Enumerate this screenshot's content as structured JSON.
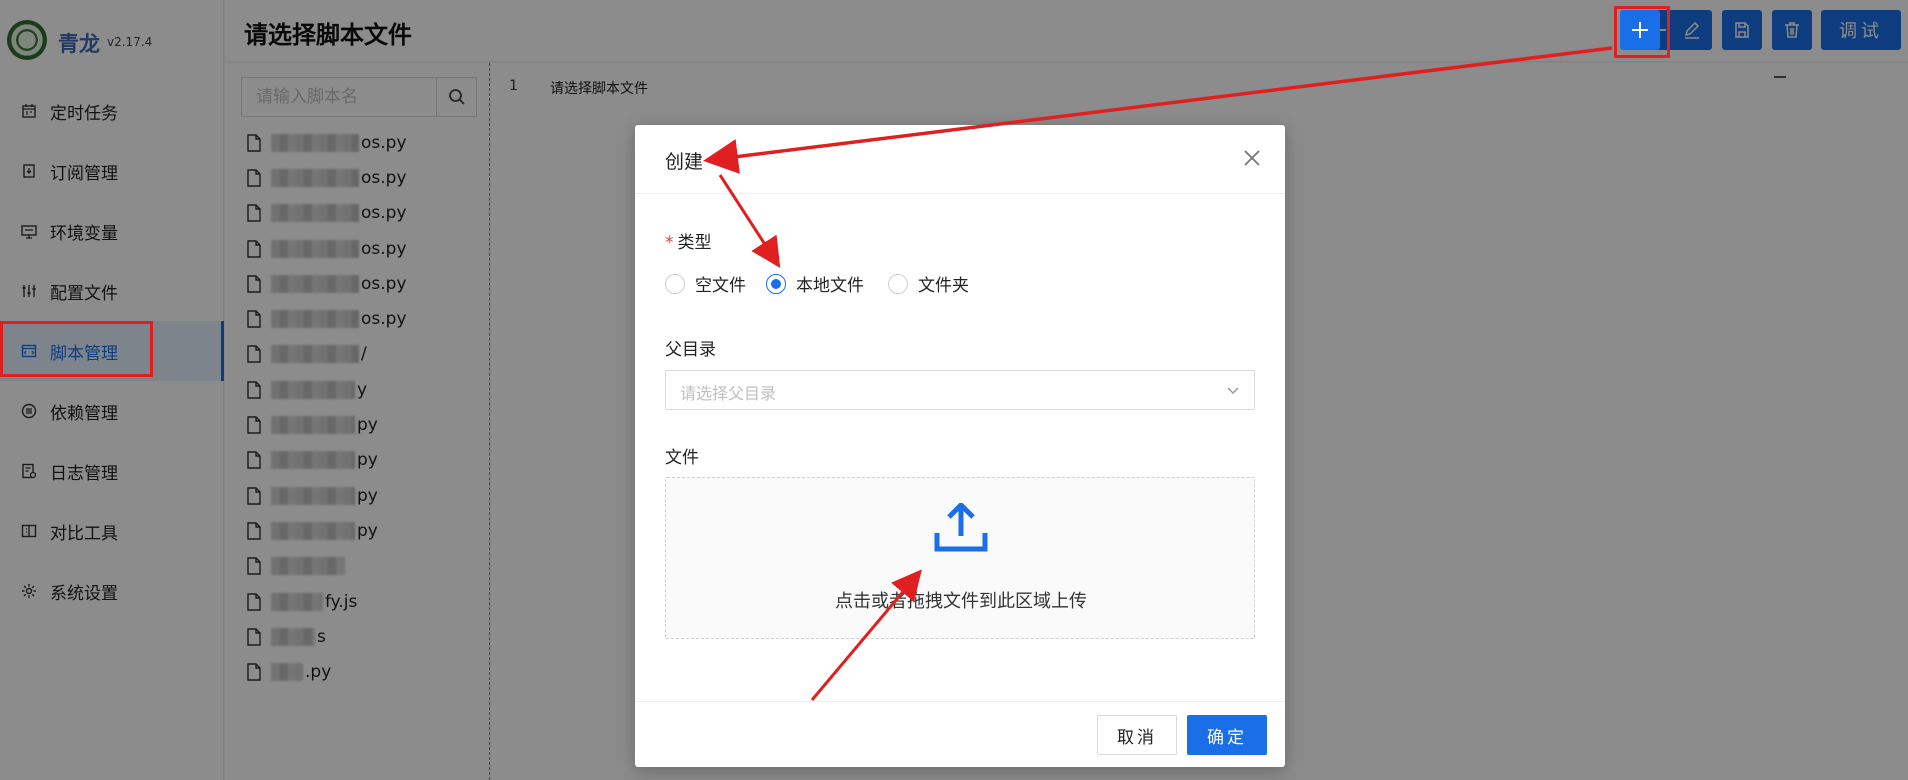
{
  "app": {
    "name": "青龙",
    "version": "v2.17.4"
  },
  "sidebar": {
    "items": [
      {
        "label": "定时任务",
        "icon": "calendar-icon"
      },
      {
        "label": "订阅管理",
        "icon": "subscription-icon"
      },
      {
        "label": "环境变量",
        "icon": "monitor-icon"
      },
      {
        "label": "配置文件",
        "icon": "sliders-icon"
      },
      {
        "label": "脚本管理",
        "icon": "code-icon",
        "active": true
      },
      {
        "label": "依赖管理",
        "icon": "list-icon"
      },
      {
        "label": "日志管理",
        "icon": "log-icon"
      },
      {
        "label": "对比工具",
        "icon": "diff-icon"
      },
      {
        "label": "系统设置",
        "icon": "gear-icon"
      }
    ]
  },
  "header": {
    "title": "请选择脚本文件",
    "debug_label": "调试",
    "tools": [
      "plus-icon",
      "edit-icon",
      "save-icon",
      "delete-icon"
    ]
  },
  "file_panel": {
    "search_placeholder": "请输入脚本名",
    "files": [
      {
        "visible": "os.py"
      },
      {
        "visible": "os.py"
      },
      {
        "visible": "os.py"
      },
      {
        "visible": "os.py"
      },
      {
        "visible": "os.py"
      },
      {
        "visible": "os.py"
      },
      {
        "visible": "/"
      },
      {
        "visible": "y"
      },
      {
        "visible": "py"
      },
      {
        "visible": "py"
      },
      {
        "visible": "py"
      },
      {
        "visible": "py"
      },
      {
        "visible": ""
      },
      {
        "visible": "fy.js"
      },
      {
        "visible": "s"
      },
      {
        "visible": ".py"
      }
    ]
  },
  "editor": {
    "line_number": "1",
    "line_text": "请选择脚本文件"
  },
  "modal": {
    "title": "创建",
    "type_label": "类型",
    "type_options": [
      {
        "label": "空文件",
        "checked": false
      },
      {
        "label": "本地文件",
        "checked": true
      },
      {
        "label": "文件夹",
        "checked": false
      }
    ],
    "parent_label": "父目录",
    "parent_placeholder": "请选择父目录",
    "file_label": "文件",
    "upload_text": "点击或者拖拽文件到此区域上传",
    "cancel_label": "取消",
    "ok_label": "确定"
  },
  "colors": {
    "primary": "#1a6fe8",
    "annotation": "#e02020",
    "brand_text": "#3e69b7"
  }
}
